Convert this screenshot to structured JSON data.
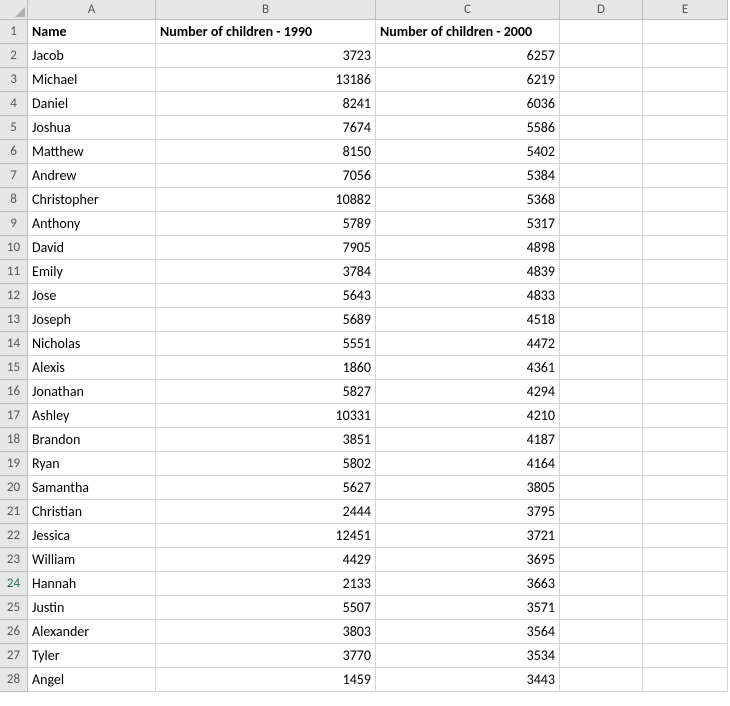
{
  "columns": [
    "A",
    "B",
    "C",
    "D",
    "E"
  ],
  "header_row_number": 1,
  "selected_row_number": 24,
  "headers": {
    "A": "Name",
    "B": "Number of children - 1990",
    "C": "Number of children - 2000"
  },
  "rows": [
    {
      "n": 2,
      "name": "Jacob",
      "y1990": 3723,
      "y2000": 6257
    },
    {
      "n": 3,
      "name": "Michael",
      "y1990": 13186,
      "y2000": 6219
    },
    {
      "n": 4,
      "name": "Daniel",
      "y1990": 8241,
      "y2000": 6036
    },
    {
      "n": 5,
      "name": "Joshua",
      "y1990": 7674,
      "y2000": 5586
    },
    {
      "n": 6,
      "name": "Matthew",
      "y1990": 8150,
      "y2000": 5402
    },
    {
      "n": 7,
      "name": "Andrew",
      "y1990": 7056,
      "y2000": 5384
    },
    {
      "n": 8,
      "name": "Christopher",
      "y1990": 10882,
      "y2000": 5368
    },
    {
      "n": 9,
      "name": "Anthony",
      "y1990": 5789,
      "y2000": 5317
    },
    {
      "n": 10,
      "name": "David",
      "y1990": 7905,
      "y2000": 4898
    },
    {
      "n": 11,
      "name": "Emily",
      "y1990": 3784,
      "y2000": 4839
    },
    {
      "n": 12,
      "name": "Jose",
      "y1990": 5643,
      "y2000": 4833
    },
    {
      "n": 13,
      "name": "Joseph",
      "y1990": 5689,
      "y2000": 4518
    },
    {
      "n": 14,
      "name": "Nicholas",
      "y1990": 5551,
      "y2000": 4472
    },
    {
      "n": 15,
      "name": "Alexis",
      "y1990": 1860,
      "y2000": 4361
    },
    {
      "n": 16,
      "name": "Jonathan",
      "y1990": 5827,
      "y2000": 4294
    },
    {
      "n": 17,
      "name": "Ashley",
      "y1990": 10331,
      "y2000": 4210
    },
    {
      "n": 18,
      "name": "Brandon",
      "y1990": 3851,
      "y2000": 4187
    },
    {
      "n": 19,
      "name": "Ryan",
      "y1990": 5802,
      "y2000": 4164
    },
    {
      "n": 20,
      "name": "Samantha",
      "y1990": 5627,
      "y2000": 3805
    },
    {
      "n": 21,
      "name": "Christian",
      "y1990": 2444,
      "y2000": 3795
    },
    {
      "n": 22,
      "name": "Jessica",
      "y1990": 12451,
      "y2000": 3721
    },
    {
      "n": 23,
      "name": "William",
      "y1990": 4429,
      "y2000": 3695
    },
    {
      "n": 24,
      "name": "Hannah",
      "y1990": 2133,
      "y2000": 3663
    },
    {
      "n": 25,
      "name": "Justin",
      "y1990": 5507,
      "y2000": 3571
    },
    {
      "n": 26,
      "name": "Alexander",
      "y1990": 3803,
      "y2000": 3564
    },
    {
      "n": 27,
      "name": "Tyler",
      "y1990": 3770,
      "y2000": 3534
    },
    {
      "n": 28,
      "name": "Angel",
      "y1990": 1459,
      "y2000": 3443
    }
  ]
}
